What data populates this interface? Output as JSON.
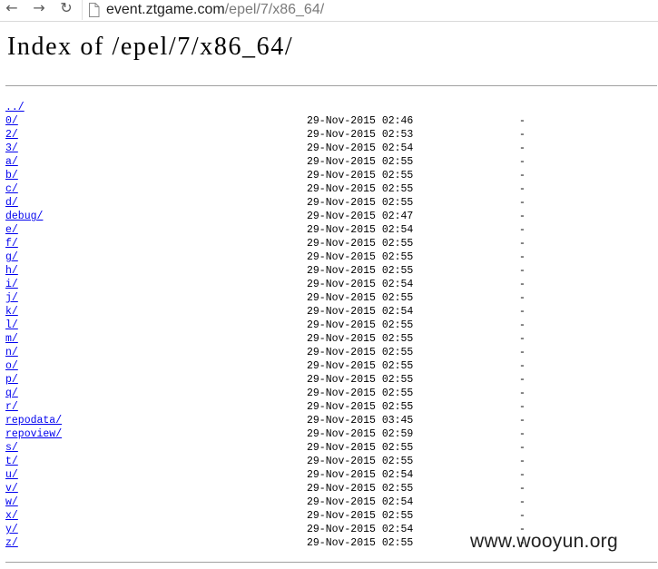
{
  "browser": {
    "back_glyph": "←",
    "forward_glyph": "→",
    "reload_glyph": "↻",
    "url_host": "event.ztgame.com",
    "url_path": "/epel/7/x86_64/"
  },
  "page": {
    "title": "Index of /epel/7/x86_64/"
  },
  "parent_link": "../",
  "entries": [
    {
      "name": "0/",
      "date": "29-Nov-2015 02:46",
      "size": "-"
    },
    {
      "name": "2/",
      "date": "29-Nov-2015 02:53",
      "size": "-"
    },
    {
      "name": "3/",
      "date": "29-Nov-2015 02:54",
      "size": "-"
    },
    {
      "name": "a/",
      "date": "29-Nov-2015 02:55",
      "size": "-"
    },
    {
      "name": "b/",
      "date": "29-Nov-2015 02:55",
      "size": "-"
    },
    {
      "name": "c/",
      "date": "29-Nov-2015 02:55",
      "size": "-"
    },
    {
      "name": "d/",
      "date": "29-Nov-2015 02:55",
      "size": "-"
    },
    {
      "name": "debug/",
      "date": "29-Nov-2015 02:47",
      "size": "-"
    },
    {
      "name": "e/",
      "date": "29-Nov-2015 02:54",
      "size": "-"
    },
    {
      "name": "f/",
      "date": "29-Nov-2015 02:55",
      "size": "-"
    },
    {
      "name": "g/",
      "date": "29-Nov-2015 02:55",
      "size": "-"
    },
    {
      "name": "h/",
      "date": "29-Nov-2015 02:55",
      "size": "-"
    },
    {
      "name": "i/",
      "date": "29-Nov-2015 02:54",
      "size": "-"
    },
    {
      "name": "j/",
      "date": "29-Nov-2015 02:55",
      "size": "-"
    },
    {
      "name": "k/",
      "date": "29-Nov-2015 02:54",
      "size": "-"
    },
    {
      "name": "l/",
      "date": "29-Nov-2015 02:55",
      "size": "-"
    },
    {
      "name": "m/",
      "date": "29-Nov-2015 02:55",
      "size": "-"
    },
    {
      "name": "n/",
      "date": "29-Nov-2015 02:55",
      "size": "-"
    },
    {
      "name": "o/",
      "date": "29-Nov-2015 02:55",
      "size": "-"
    },
    {
      "name": "p/",
      "date": "29-Nov-2015 02:55",
      "size": "-"
    },
    {
      "name": "q/",
      "date": "29-Nov-2015 02:55",
      "size": "-"
    },
    {
      "name": "r/",
      "date": "29-Nov-2015 02:55",
      "size": "-"
    },
    {
      "name": "repodata/",
      "date": "29-Nov-2015 03:45",
      "size": "-"
    },
    {
      "name": "repoview/",
      "date": "29-Nov-2015 02:59",
      "size": "-"
    },
    {
      "name": "s/",
      "date": "29-Nov-2015 02:55",
      "size": "-"
    },
    {
      "name": "t/",
      "date": "29-Nov-2015 02:55",
      "size": "-"
    },
    {
      "name": "u/",
      "date": "29-Nov-2015 02:54",
      "size": "-"
    },
    {
      "name": "v/",
      "date": "29-Nov-2015 02:55",
      "size": "-"
    },
    {
      "name": "w/",
      "date": "29-Nov-2015 02:54",
      "size": "-"
    },
    {
      "name": "x/",
      "date": "29-Nov-2015 02:55",
      "size": "-"
    },
    {
      "name": "y/",
      "date": "29-Nov-2015 02:54",
      "size": "-"
    },
    {
      "name": "z/",
      "date": "29-Nov-2015 02:55",
      "size": "-"
    }
  ],
  "watermark": "www.wooyun.org",
  "colors": {
    "link": "#0000ee",
    "rule": "#a0a0a0",
    "url_path": "#7a7a7a"
  }
}
